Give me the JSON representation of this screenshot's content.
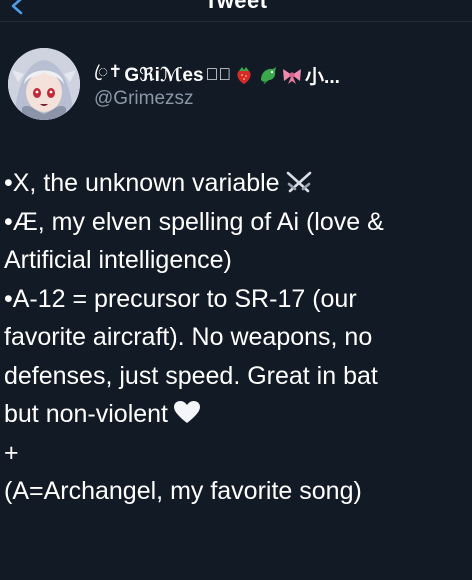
{
  "nav": {
    "title": "Tweet",
    "back_icon": "chevron-left-icon"
  },
  "author": {
    "name_prefix": "ꦿ✝",
    "name": "Gℜiℳes",
    "name_suffix": "✝ꦿ",
    "name_trailing": "小...",
    "handle": "@Grimezsz",
    "emojis": [
      "strawberry-emoji",
      "dragon-emoji",
      "ribbon-emoji"
    ]
  },
  "tweet": {
    "lines": [
      "•X, the unknown variable",
      "•Æ, my elven spelling of Ai (love &",
      "Artificial intelligence)",
      "•A-12 = precursor to SR-17 (our",
      "favorite aircraft).  No weapons, no",
      "defenses, just speed.  Great in bat",
      "but non-violent",
      "+",
      "(A=Archangel, my favorite song)"
    ],
    "icons": [
      "crossed-swords-icon",
      "white-heart-icon"
    ]
  },
  "colors": {
    "background": "#121a26",
    "text": "#ffffff",
    "handle": "#8a97a6",
    "strawberry": "#d62a2a",
    "dragon": "#3aa84a",
    "ribbon": "#f08bb0"
  }
}
